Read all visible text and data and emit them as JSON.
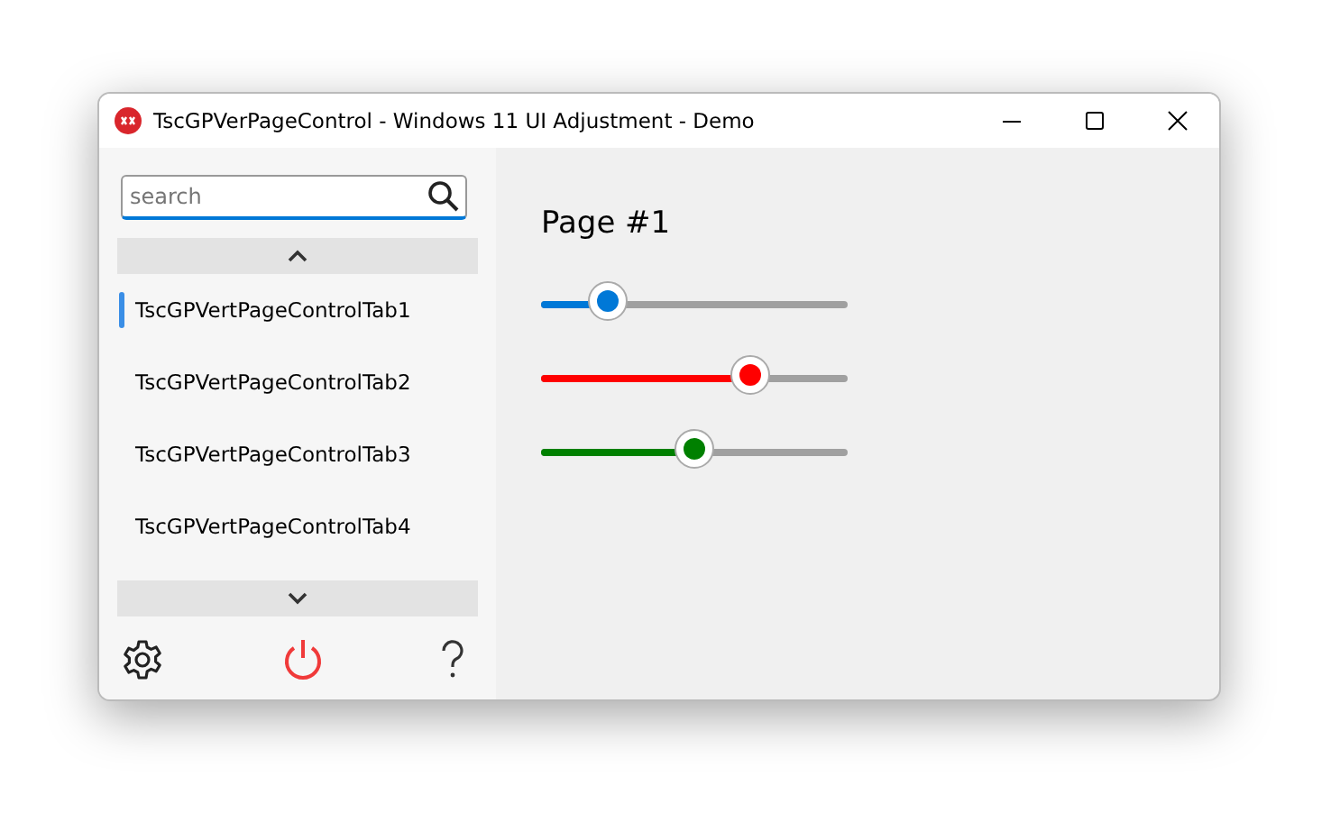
{
  "window": {
    "title": "TscGPVerPageControl - Windows 11 UI Adjustment - Demo"
  },
  "search": {
    "placeholder": "search"
  },
  "tabs": [
    {
      "label": "TscGPVertPageControlTab1",
      "selected": true
    },
    {
      "label": "TscGPVertPageControlTab2",
      "selected": false
    },
    {
      "label": "TscGPVertPageControlTab3",
      "selected": false
    },
    {
      "label": "TscGPVertPageControlTab4",
      "selected": false
    }
  ],
  "page": {
    "title": "Page #1",
    "sliders": [
      {
        "color": "#0078d7",
        "level": 0.22
      },
      {
        "color": "#ff0000",
        "level": 0.68
      },
      {
        "color": "#008000",
        "level": 0.5
      }
    ]
  }
}
